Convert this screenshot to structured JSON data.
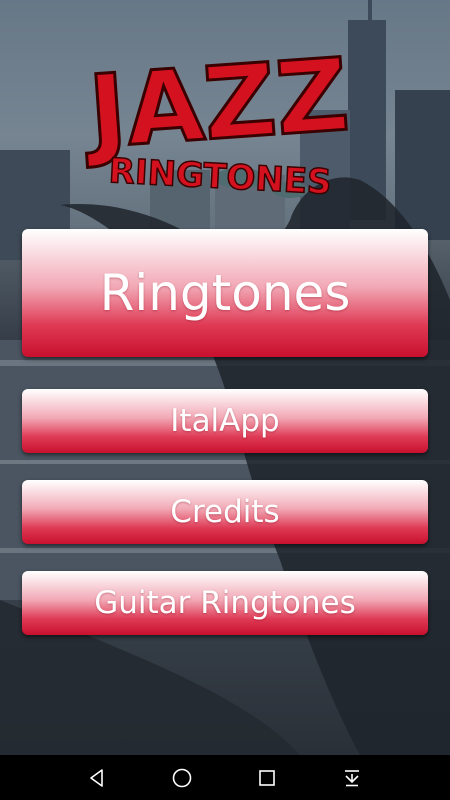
{
  "logo": {
    "title": "JAZZ",
    "subtitle": "RINGTONES"
  },
  "menu": {
    "main_button": "Ringtones",
    "buttons": [
      "ItalApp",
      "Credits",
      "Guitar Ringtones"
    ]
  },
  "navbar": {
    "icons": [
      "back-icon",
      "home-icon",
      "recent-apps-icon",
      "notification-down-icon"
    ]
  },
  "colors": {
    "accent_red": "#c8102e",
    "logo_red": "#d4111e",
    "navbar": "#000000"
  }
}
